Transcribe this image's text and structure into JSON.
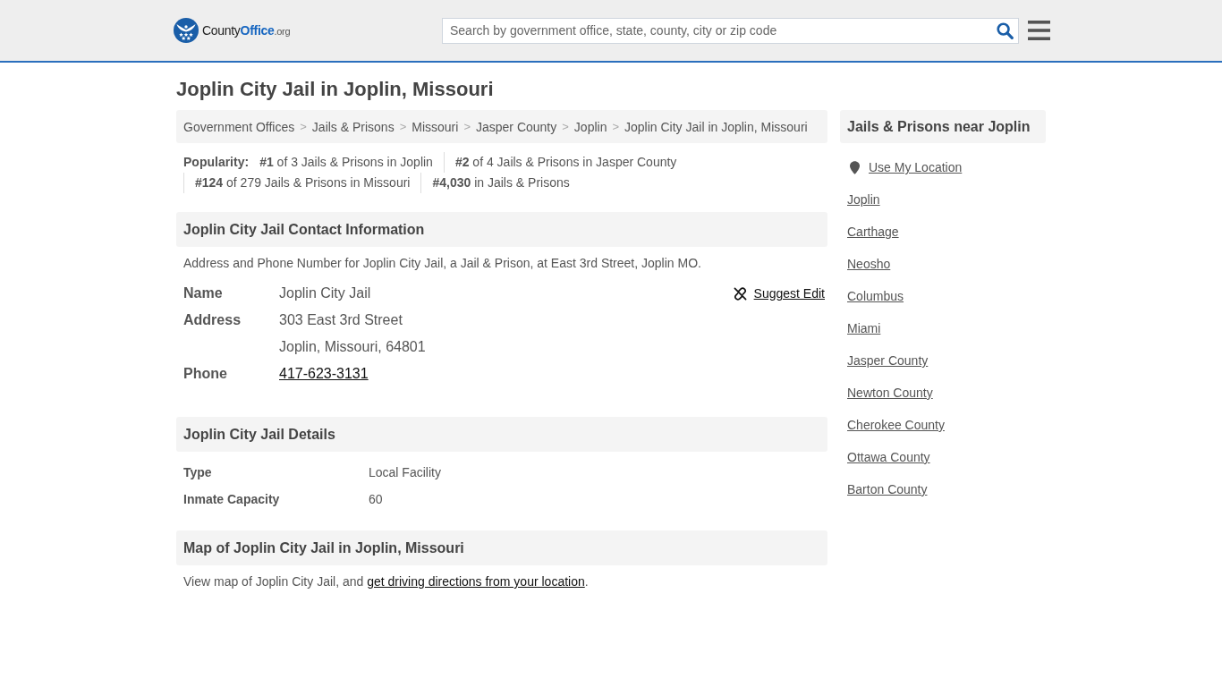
{
  "header": {
    "logo": {
      "parts": [
        "County",
        "Office",
        ".org"
      ]
    },
    "search": {
      "placeholder": "Search by government office, state, county, city or zip code"
    }
  },
  "page_title": "Joplin City Jail in Joplin, Missouri",
  "breadcrumb": {
    "separator": ">",
    "items": [
      "Government Offices",
      "Jails & Prisons",
      "Missouri",
      "Jasper County",
      "Joplin",
      "Joplin City Jail in Joplin, Missouri"
    ]
  },
  "popularity": {
    "label": "Popularity:",
    "ranks": [
      "**#1** of 3 Jails & Prisons in Joplin",
      "**#2** of 4 Jails & Prisons in Jasper County",
      "**#124** of 279 Jails & Prisons in Missouri",
      "**#4,030** in Jails & Prisons"
    ]
  },
  "contact": {
    "title": "Joplin City Jail Contact Information",
    "description": "Address and Phone Number for Joplin City Jail, a Jail & Prison, at East 3rd Street, Joplin MO.",
    "suggest_edit": "Suggest Edit",
    "rows": [
      {
        "label": "Name",
        "kind": "text",
        "values": [
          "Joplin City Jail"
        ]
      },
      {
        "label": "Address",
        "kind": "text",
        "values": [
          "303 East 3rd Street",
          "Joplin, Missouri, 64801"
        ]
      },
      {
        "label": "Phone",
        "kind": "link",
        "values": [
          "417-623-3131"
        ]
      }
    ]
  },
  "details": {
    "title": "Joplin City Jail Details",
    "rows": [
      {
        "label": "Type",
        "value": "Local Facility"
      },
      {
        "label": "Inmate Capacity",
        "value": "60"
      }
    ]
  },
  "map": {
    "title": "Map of Joplin City Jail in Joplin, Missouri",
    "text_before": "View map of Joplin City Jail, and ",
    "link": "get driving directions from your location",
    "text_after": "."
  },
  "sidebar": {
    "title": "Jails & Prisons near Joplin",
    "use_location": "Use My Location",
    "links": [
      "Joplin",
      "Carthage",
      "Neosho",
      "Columbus",
      "Miami",
      "Jasper County",
      "Newton County",
      "Cherokee County",
      "Ottawa County",
      "Barton County"
    ]
  }
}
